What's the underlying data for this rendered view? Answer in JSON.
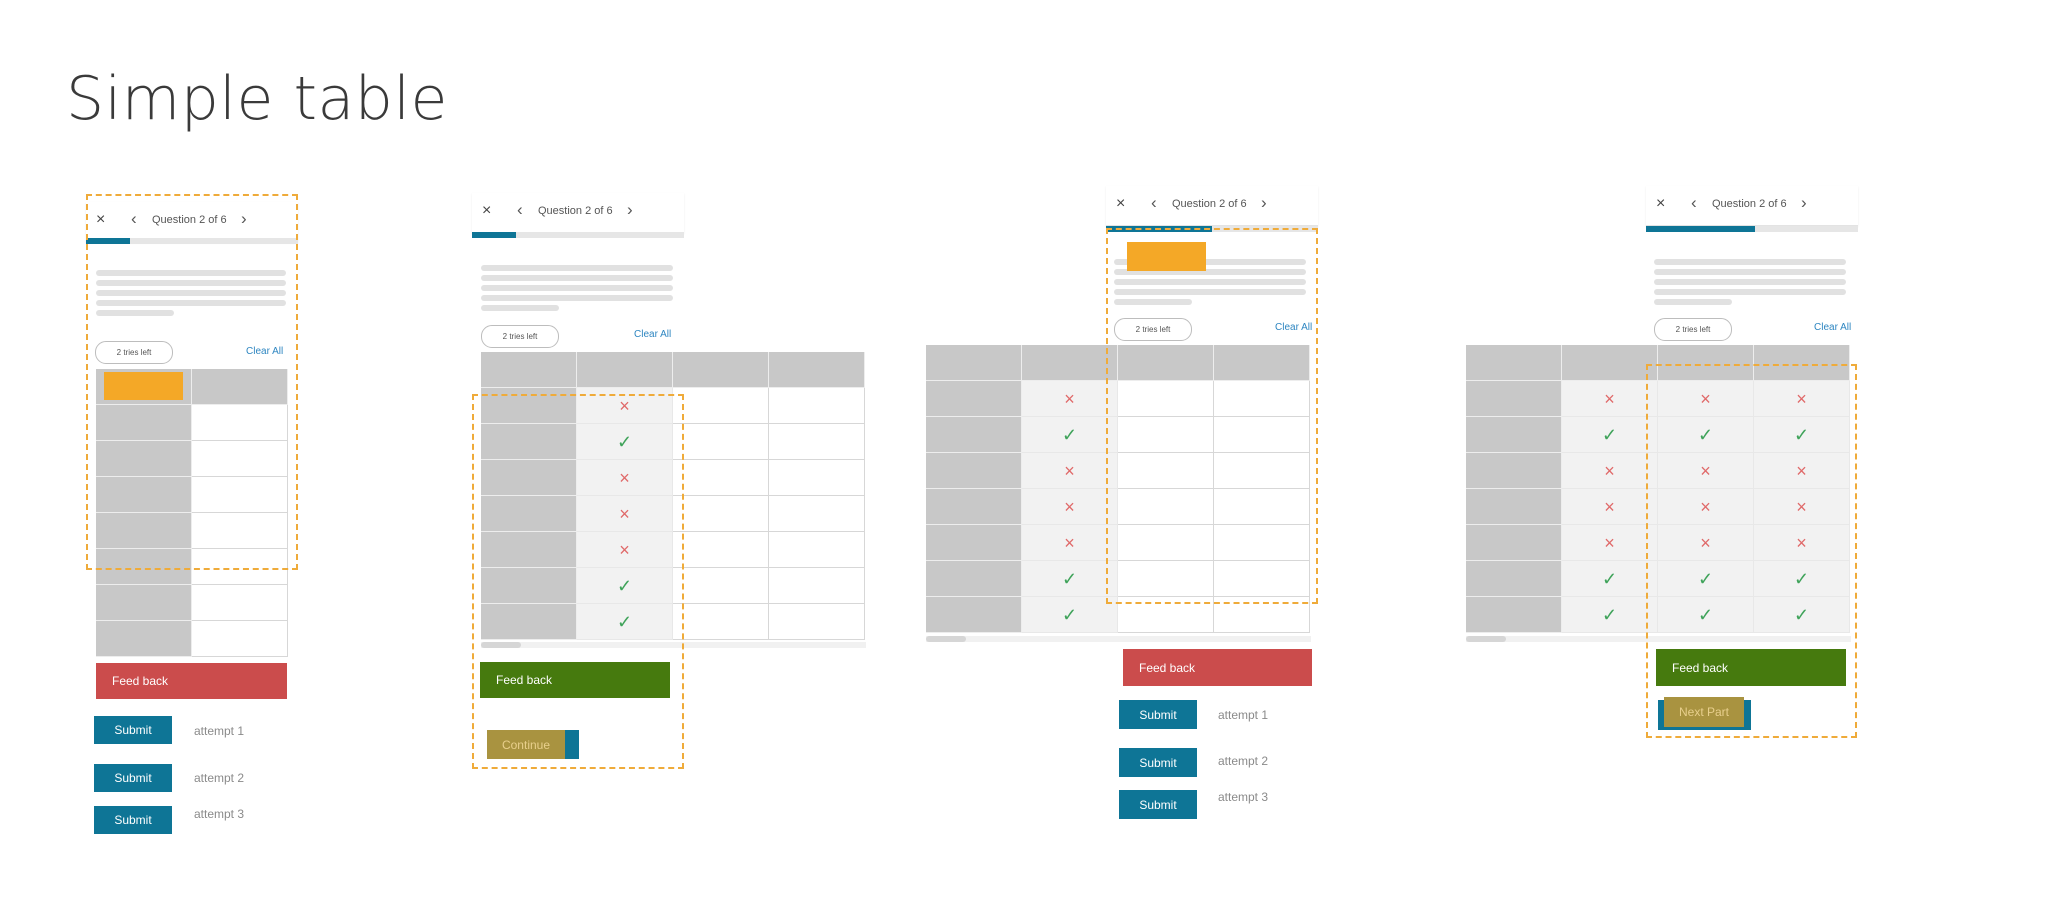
{
  "page_title": "Simple table",
  "header": {
    "question": "Question 2 of 6",
    "close_icon": "×",
    "prev_icon": "‹",
    "next_icon": "›"
  },
  "tries_left": "2 tries left",
  "clear_all": "Clear All",
  "marks": {
    "incorrect": "×",
    "correct": "✓"
  },
  "feedback_label": "Feed back",
  "submit_label": "Submit",
  "attempts": [
    "attempt 1",
    "attempt 2",
    "attempt 3"
  ],
  "continue_label": "Continue",
  "next_part_label": "Next Part",
  "colors": {
    "accent": "#0e7596",
    "feedback_incorrect": "#cb4c4c",
    "feedback_correct": "#467a0e",
    "highlight": "#f4a827",
    "dashed_outline": "#efab3a"
  }
}
